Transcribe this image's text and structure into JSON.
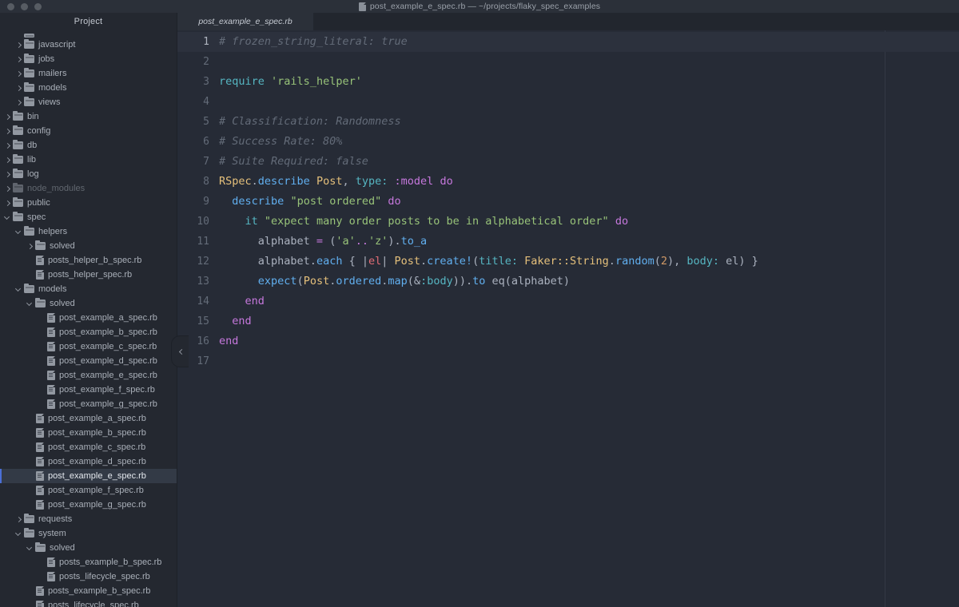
{
  "window": {
    "title": "post_example_e_spec.rb — ~/projects/flaky_spec_examples",
    "title_icon": "ruby-file-icon",
    "traffic_lights": [
      "close-button",
      "minimize-button",
      "zoom-button"
    ]
  },
  "sidebar": {
    "header": "Project",
    "collapse_icon": "chevron-left-icon",
    "items": [
      {
        "label": "",
        "type": "folder",
        "depth": 2,
        "state": "partial",
        "partial": true
      },
      {
        "label": "javascript",
        "type": "folder",
        "depth": 2,
        "state": "collapsed"
      },
      {
        "label": "jobs",
        "type": "folder",
        "depth": 2,
        "state": "collapsed"
      },
      {
        "label": "mailers",
        "type": "folder",
        "depth": 2,
        "state": "collapsed"
      },
      {
        "label": "models",
        "type": "folder",
        "depth": 2,
        "state": "collapsed"
      },
      {
        "label": "views",
        "type": "folder",
        "depth": 2,
        "state": "collapsed"
      },
      {
        "label": "bin",
        "type": "folder",
        "depth": 1,
        "state": "collapsed"
      },
      {
        "label": "config",
        "type": "folder",
        "depth": 1,
        "state": "collapsed"
      },
      {
        "label": "db",
        "type": "folder",
        "depth": 1,
        "state": "collapsed"
      },
      {
        "label": "lib",
        "type": "folder",
        "depth": 1,
        "state": "collapsed"
      },
      {
        "label": "log",
        "type": "folder",
        "depth": 1,
        "state": "collapsed"
      },
      {
        "label": "node_modules",
        "type": "folder",
        "depth": 1,
        "state": "collapsed",
        "dimmed": true
      },
      {
        "label": "public",
        "type": "folder",
        "depth": 1,
        "state": "collapsed"
      },
      {
        "label": "spec",
        "type": "folder",
        "depth": 1,
        "state": "expanded"
      },
      {
        "label": "helpers",
        "type": "folder",
        "depth": 2,
        "state": "expanded"
      },
      {
        "label": "solved",
        "type": "folder",
        "depth": 3,
        "state": "collapsed"
      },
      {
        "label": "posts_helper_b_spec.rb",
        "type": "file",
        "depth": 3
      },
      {
        "label": "posts_helper_spec.rb",
        "type": "file",
        "depth": 3
      },
      {
        "label": "models",
        "type": "folder",
        "depth": 2,
        "state": "expanded"
      },
      {
        "label": "solved",
        "type": "folder",
        "depth": 3,
        "state": "expanded"
      },
      {
        "label": "post_example_a_spec.rb",
        "type": "file",
        "depth": 4
      },
      {
        "label": "post_example_b_spec.rb",
        "type": "file",
        "depth": 4
      },
      {
        "label": "post_example_c_spec.rb",
        "type": "file",
        "depth": 4
      },
      {
        "label": "post_example_d_spec.rb",
        "type": "file",
        "depth": 4
      },
      {
        "label": "post_example_e_spec.rb",
        "type": "file",
        "depth": 4
      },
      {
        "label": "post_example_f_spec.rb",
        "type": "file",
        "depth": 4
      },
      {
        "label": "post_example_g_spec.rb",
        "type": "file",
        "depth": 4
      },
      {
        "label": "post_example_a_spec.rb",
        "type": "file",
        "depth": 3
      },
      {
        "label": "post_example_b_spec.rb",
        "type": "file",
        "depth": 3
      },
      {
        "label": "post_example_c_spec.rb",
        "type": "file",
        "depth": 3
      },
      {
        "label": "post_example_d_spec.rb",
        "type": "file",
        "depth": 3
      },
      {
        "label": "post_example_e_spec.rb",
        "type": "file",
        "depth": 3,
        "selected": true
      },
      {
        "label": "post_example_f_spec.rb",
        "type": "file",
        "depth": 3
      },
      {
        "label": "post_example_g_spec.rb",
        "type": "file",
        "depth": 3
      },
      {
        "label": "requests",
        "type": "folder",
        "depth": 2,
        "state": "collapsed"
      },
      {
        "label": "system",
        "type": "folder",
        "depth": 2,
        "state": "expanded"
      },
      {
        "label": "solved",
        "type": "folder",
        "depth": 3,
        "state": "expanded"
      },
      {
        "label": "posts_example_b_spec.rb",
        "type": "file",
        "depth": 4
      },
      {
        "label": "posts_lifecycle_spec.rb",
        "type": "file",
        "depth": 4
      },
      {
        "label": "posts_example_b_spec.rb",
        "type": "file",
        "depth": 3
      },
      {
        "label": "posts_lifecycle_spec.rb",
        "type": "file",
        "depth": 3
      }
    ]
  },
  "editor": {
    "tabs": [
      {
        "label": "post_example_e_spec.rb",
        "active": true
      }
    ],
    "current_line": 1,
    "ruler_column": 80,
    "lines": [
      {
        "n": "1",
        "tokens": [
          {
            "t": "# frozen_string_literal: true",
            "c": "t-comment"
          }
        ]
      },
      {
        "n": "2",
        "tokens": []
      },
      {
        "n": "3",
        "tokens": [
          {
            "t": "require",
            "c": "t-param"
          },
          {
            "t": " ",
            "c": "t-plain"
          },
          {
            "t": "'rails_helper'",
            "c": "t-str"
          }
        ]
      },
      {
        "n": "4",
        "tokens": []
      },
      {
        "n": "5",
        "tokens": [
          {
            "t": "# Classification: Randomness",
            "c": "t-comment"
          }
        ]
      },
      {
        "n": "6",
        "tokens": [
          {
            "t": "# Success Rate: 80%",
            "c": "t-comment"
          }
        ]
      },
      {
        "n": "7",
        "tokens": [
          {
            "t": "# Suite Required: false",
            "c": "t-comment"
          }
        ]
      },
      {
        "n": "8",
        "tokens": [
          {
            "t": "RSpec",
            "c": "t-const"
          },
          {
            "t": ".",
            "c": "t-punct"
          },
          {
            "t": "describe",
            "c": "t-method"
          },
          {
            "t": " ",
            "c": "t-plain"
          },
          {
            "t": "Post",
            "c": "t-const"
          },
          {
            "t": ", ",
            "c": "t-punct"
          },
          {
            "t": "type:",
            "c": "t-param"
          },
          {
            "t": " ",
            "c": "t-plain"
          },
          {
            "t": ":model",
            "c": "t-sym"
          },
          {
            "t": " ",
            "c": "t-plain"
          },
          {
            "t": "do",
            "c": "t-kw"
          }
        ]
      },
      {
        "n": "9",
        "tokens": [
          {
            "t": "  ",
            "c": "t-plain"
          },
          {
            "t": "describe",
            "c": "t-method"
          },
          {
            "t": " ",
            "c": "t-plain"
          },
          {
            "t": "\"post ordered\"",
            "c": "t-str"
          },
          {
            "t": " ",
            "c": "t-plain"
          },
          {
            "t": "do",
            "c": "t-kw"
          }
        ]
      },
      {
        "n": "10",
        "tokens": [
          {
            "t": "    ",
            "c": "t-plain"
          },
          {
            "t": "it",
            "c": "t-param"
          },
          {
            "t": " ",
            "c": "t-plain"
          },
          {
            "t": "\"expect many order posts to be in alphabetical order\"",
            "c": "t-str"
          },
          {
            "t": " ",
            "c": "t-plain"
          },
          {
            "t": "do",
            "c": "t-kw"
          }
        ]
      },
      {
        "n": "11",
        "tokens": [
          {
            "t": "      alphabet ",
            "c": "t-plain"
          },
          {
            "t": "=",
            "c": "t-op"
          },
          {
            "t": " (",
            "c": "t-punct"
          },
          {
            "t": "'a'",
            "c": "t-str"
          },
          {
            "t": "..",
            "c": "t-op"
          },
          {
            "t": "'z'",
            "c": "t-str"
          },
          {
            "t": ").",
            "c": "t-punct"
          },
          {
            "t": "to_a",
            "c": "t-method"
          }
        ]
      },
      {
        "n": "12",
        "tokens": [
          {
            "t": "      alphabet",
            "c": "t-plain"
          },
          {
            "t": ".",
            "c": "t-punct"
          },
          {
            "t": "each",
            "c": "t-method"
          },
          {
            "t": " { |",
            "c": "t-punct"
          },
          {
            "t": "el",
            "c": "t-var"
          },
          {
            "t": "| ",
            "c": "t-punct"
          },
          {
            "t": "Post",
            "c": "t-const"
          },
          {
            "t": ".",
            "c": "t-punct"
          },
          {
            "t": "create!",
            "c": "t-method"
          },
          {
            "t": "(",
            "c": "t-punct"
          },
          {
            "t": "title:",
            "c": "t-param"
          },
          {
            "t": " ",
            "c": "t-plain"
          },
          {
            "t": "Faker::String",
            "c": "t-const"
          },
          {
            "t": ".",
            "c": "t-punct"
          },
          {
            "t": "random",
            "c": "t-method"
          },
          {
            "t": "(",
            "c": "t-punct"
          },
          {
            "t": "2",
            "c": "t-num"
          },
          {
            "t": "), ",
            "c": "t-punct"
          },
          {
            "t": "body:",
            "c": "t-param"
          },
          {
            "t": " el) }",
            "c": "t-punct"
          }
        ]
      },
      {
        "n": "13",
        "tokens": [
          {
            "t": "      ",
            "c": "t-plain"
          },
          {
            "t": "expect",
            "c": "t-method"
          },
          {
            "t": "(",
            "c": "t-punct"
          },
          {
            "t": "Post",
            "c": "t-const"
          },
          {
            "t": ".",
            "c": "t-punct"
          },
          {
            "t": "ordered",
            "c": "t-method"
          },
          {
            "t": ".",
            "c": "t-punct"
          },
          {
            "t": "map",
            "c": "t-method"
          },
          {
            "t": "(&",
            "c": "t-punct"
          },
          {
            "t": ":body",
            "c": "t-param"
          },
          {
            "t": "))",
            "c": "t-punct"
          },
          {
            "t": ".",
            "c": "t-punct"
          },
          {
            "t": "to",
            "c": "t-method"
          },
          {
            "t": " eq(alphabet)",
            "c": "t-plain"
          }
        ]
      },
      {
        "n": "14",
        "tokens": [
          {
            "t": "    ",
            "c": "t-plain"
          },
          {
            "t": "end",
            "c": "t-kw"
          }
        ]
      },
      {
        "n": "15",
        "tokens": [
          {
            "t": "  ",
            "c": "t-plain"
          },
          {
            "t": "end",
            "c": "t-kw"
          }
        ]
      },
      {
        "n": "16",
        "tokens": [
          {
            "t": "end",
            "c": "t-kw"
          }
        ]
      },
      {
        "n": "17",
        "tokens": []
      }
    ]
  },
  "colors": {
    "background": "#262b36",
    "sidebar_bg": "#242830",
    "titlebar_bg": "#2b3039",
    "selection": "#333a46",
    "accent": "#4b6fd6",
    "current_line": "#2c313d"
  }
}
